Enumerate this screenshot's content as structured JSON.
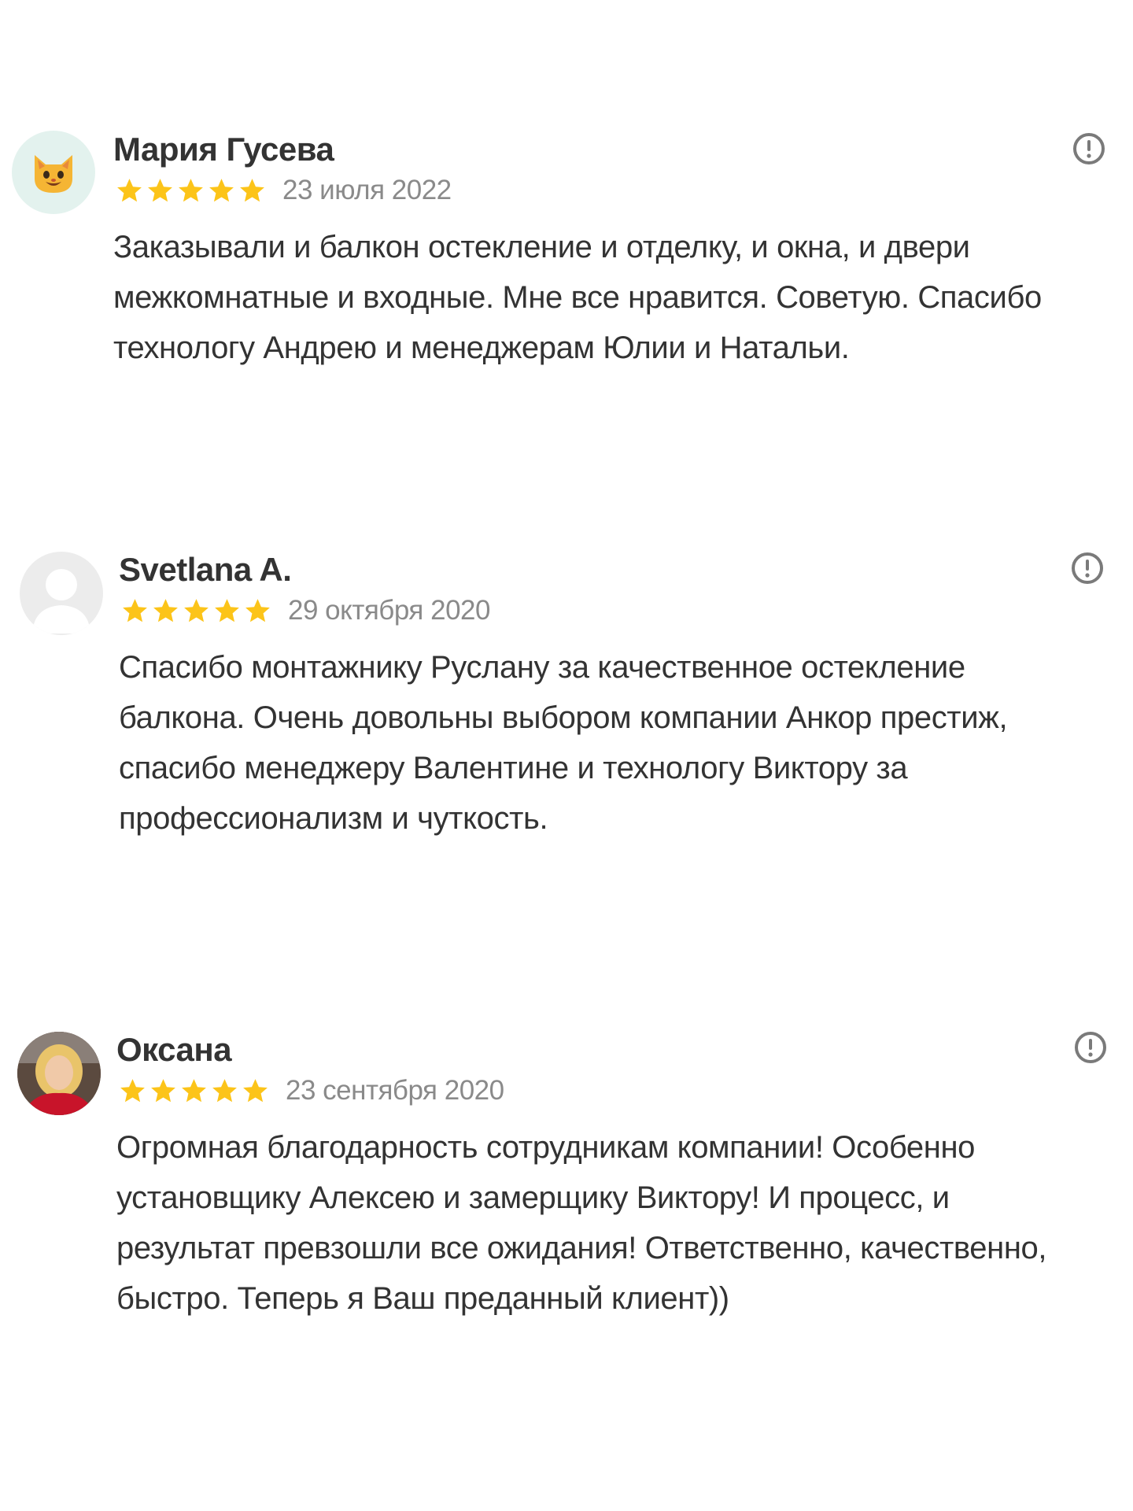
{
  "rating_color": "#fcc419",
  "reviews": [
    {
      "name": "Мария Гусева",
      "date": "23 июля 2022",
      "rating": 5,
      "avatar": "cat-emoji-avatar",
      "text": "Заказывали и балкон остекление и отделку, и окна, и двери межкомнатные и входные. Мне все нравится. Советую. Спасибо технологу Андрею и менеджерам Юлии и Натальи."
    },
    {
      "name": "Svetlana A.",
      "date": "29 октября 2020",
      "rating": 5,
      "avatar": "default-user-avatar",
      "text": "Спасибо монтажнику Руслану за качественное остекление балкона. Очень довольны выбором компании Анкор престиж, спасибо менеджеру Валентине и технологу Виктору за профессионализм и чуткость."
    },
    {
      "name": "Оксана",
      "date": "23 сентября 2020",
      "rating": 5,
      "avatar": "user-photo-avatar",
      "text": "Огромная благодарность сотрудникам компании! Особенно установщику Алексею и замерщику Виктору! И процесс, и результат превзошли все ожидания! Ответственно, качественно, быстро. Теперь я Ваш преданный клиент))"
    }
  ]
}
